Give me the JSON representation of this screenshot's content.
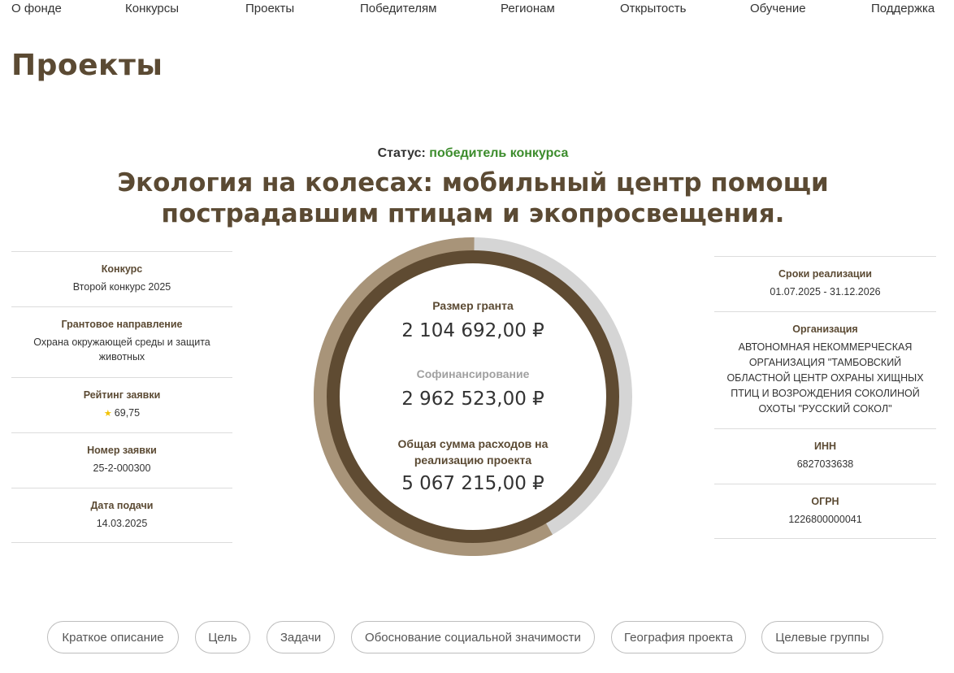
{
  "nav": {
    "items": [
      {
        "label": "О фонде"
      },
      {
        "label": "Конкурсы"
      },
      {
        "label": "Проекты"
      },
      {
        "label": "Победителям"
      },
      {
        "label": "Регионам"
      },
      {
        "label": "Открытость"
      },
      {
        "label": "Обучение"
      },
      {
        "label": "Поддержка"
      }
    ]
  },
  "page": {
    "title": "Проекты"
  },
  "status": {
    "label": "Статус:",
    "value": "победитель конкурса",
    "value_color": "#3c8c2c"
  },
  "project": {
    "title": "Экология на колесах: мобильный центр помощи пострадавшим птицам и экопросвещения."
  },
  "left_info": [
    {
      "label": "Конкурс",
      "value": "Второй конкурс 2025"
    },
    {
      "label": "Грантовое направление",
      "value": "Охрана окружающей среды и защита животных"
    },
    {
      "label": "Рейтинг заявки",
      "value": "69,75",
      "icon": "star-icon"
    },
    {
      "label": "Номер заявки",
      "value": "25-2-000300"
    },
    {
      "label": "Дата подачи",
      "value": "14.03.2025"
    }
  ],
  "right_info": [
    {
      "label": "Сроки реализации",
      "value": "01.07.2025 - 31.12.2026"
    },
    {
      "label": "Организация",
      "value": "АВТОНОМНАЯ НЕКОММЕРЧЕСКАЯ ОРГАНИЗАЦИЯ \"ТАМБОВСКИЙ ОБЛАСТНОЙ ЦЕНТР ОХРАНЫ ХИЩНЫХ ПТИЦ И ВОЗРОЖДЕНИЯ СОКОЛИНОЙ ОХОТЫ \"РУССКИЙ СОКОЛ\""
    },
    {
      "label": "ИНН",
      "value": "6827033638"
    },
    {
      "label": "ОГРН",
      "value": "1226800000041"
    }
  ],
  "finance": {
    "grant_label": "Размер гранта",
    "grant_value": "2 104 692,00 ₽",
    "cofinancing_label": "Софинансирование",
    "cofinancing_value": "2 962 523,00 ₽",
    "total_label": "Общая сумма расходов на реализацию проекта",
    "total_value": "5 067 215,00 ₽",
    "colors": {
      "grant": "#5f4b32",
      "cofinancing": "#a89479",
      "remainder": "#d5d5d5"
    }
  },
  "tabs": [
    {
      "label": "Краткое описание"
    },
    {
      "label": "Цель"
    },
    {
      "label": "Задачи"
    },
    {
      "label": "Обоснование социальной значимости"
    },
    {
      "label": "География проекта"
    },
    {
      "label": "Целевые группы"
    }
  ],
  "colors": {
    "title": "#5b4a33",
    "border": "#dcdcdc"
  }
}
